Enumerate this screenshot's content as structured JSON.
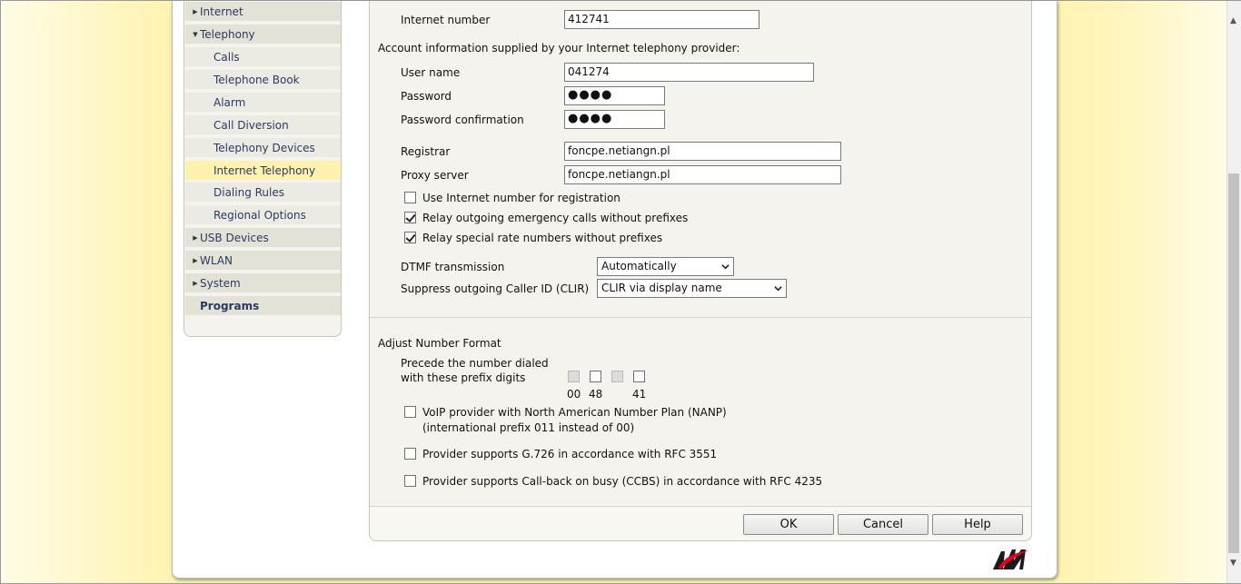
{
  "nav": {
    "items": [
      {
        "label": "Internet",
        "level": "top",
        "expanded": false
      },
      {
        "label": "Telephony",
        "level": "top",
        "expanded": true
      },
      {
        "label": "Calls",
        "level": "sub"
      },
      {
        "label": "Telephone Book",
        "level": "sub"
      },
      {
        "label": "Alarm",
        "level": "sub"
      },
      {
        "label": "Call Diversion",
        "level": "sub"
      },
      {
        "label": "Telephony Devices",
        "level": "sub"
      },
      {
        "label": "Internet Telephony",
        "level": "sub",
        "active": true
      },
      {
        "label": "Dialing Rules",
        "level": "sub"
      },
      {
        "label": "Regional Options",
        "level": "sub"
      },
      {
        "label": "USB Devices",
        "level": "top",
        "expanded": false
      },
      {
        "label": "WLAN",
        "level": "top",
        "expanded": false
      },
      {
        "label": "System",
        "level": "top",
        "expanded": false
      },
      {
        "label": "Programs",
        "level": "bold"
      }
    ]
  },
  "form": {
    "internet_number_label": "Internet number",
    "internet_number_value": "412741",
    "account_info_heading": "Account information supplied by your Internet telephony provider:",
    "username_label": "User name",
    "username_value": "041274",
    "password_label": "Password",
    "password_value": "●●●●",
    "password_confirm_label": "Password confirmation",
    "password_confirm_value": "●●●●",
    "registrar_label": "Registrar",
    "registrar_value": "foncpe.netiangn.pl",
    "proxy_label": "Proxy server",
    "proxy_value": "foncpe.netiangn.pl",
    "use_internet_number_label": "Use Internet number for registration",
    "use_internet_number_checked": false,
    "relay_emergency_label": "Relay outgoing emergency calls without prefixes",
    "relay_emergency_checked": true,
    "relay_special_label": "Relay special rate numbers without prefixes",
    "relay_special_checked": true,
    "dtmf_label": "DTMF transmission",
    "dtmf_value": "Automatically",
    "clir_label": "Suppress outgoing Caller ID (CLIR)",
    "clir_value": "CLIR via display name"
  },
  "number_format": {
    "heading": "Adjust Number Format",
    "precede_line1": "Precede the number dialed",
    "precede_line2": "with these prefix digits",
    "prefixes": [
      {
        "label": "00",
        "disabled": true,
        "checked": false
      },
      {
        "label": "48",
        "disabled": false,
        "checked": false
      },
      {
        "label": "",
        "disabled": true,
        "checked": false
      },
      {
        "label": "41",
        "disabled": false,
        "checked": false
      }
    ],
    "nanp_line1": "VoIP provider with North American Number Plan (NANP)",
    "nanp_line2": "(international prefix 011 instead of 00)",
    "nanp_checked": false,
    "g726_label": "Provider supports G.726 in accordance with RFC 3551",
    "g726_checked": false,
    "ccbs_label": "Provider supports Call-back on busy (CCBS) in accordance with RFC 4235",
    "ccbs_checked": false
  },
  "buttons": {
    "ok": "OK",
    "cancel": "Cancel",
    "help": "Help"
  },
  "icons": {
    "logo": "avm-logo-icon",
    "expand": "triangle-right-icon",
    "collapse": "triangle-down-icon",
    "dropdown": "chevron-down-icon"
  },
  "colors": {
    "nav_active": "#fff2ad",
    "nav_link": "#2a3b63",
    "logo_red": "#e2001a"
  }
}
